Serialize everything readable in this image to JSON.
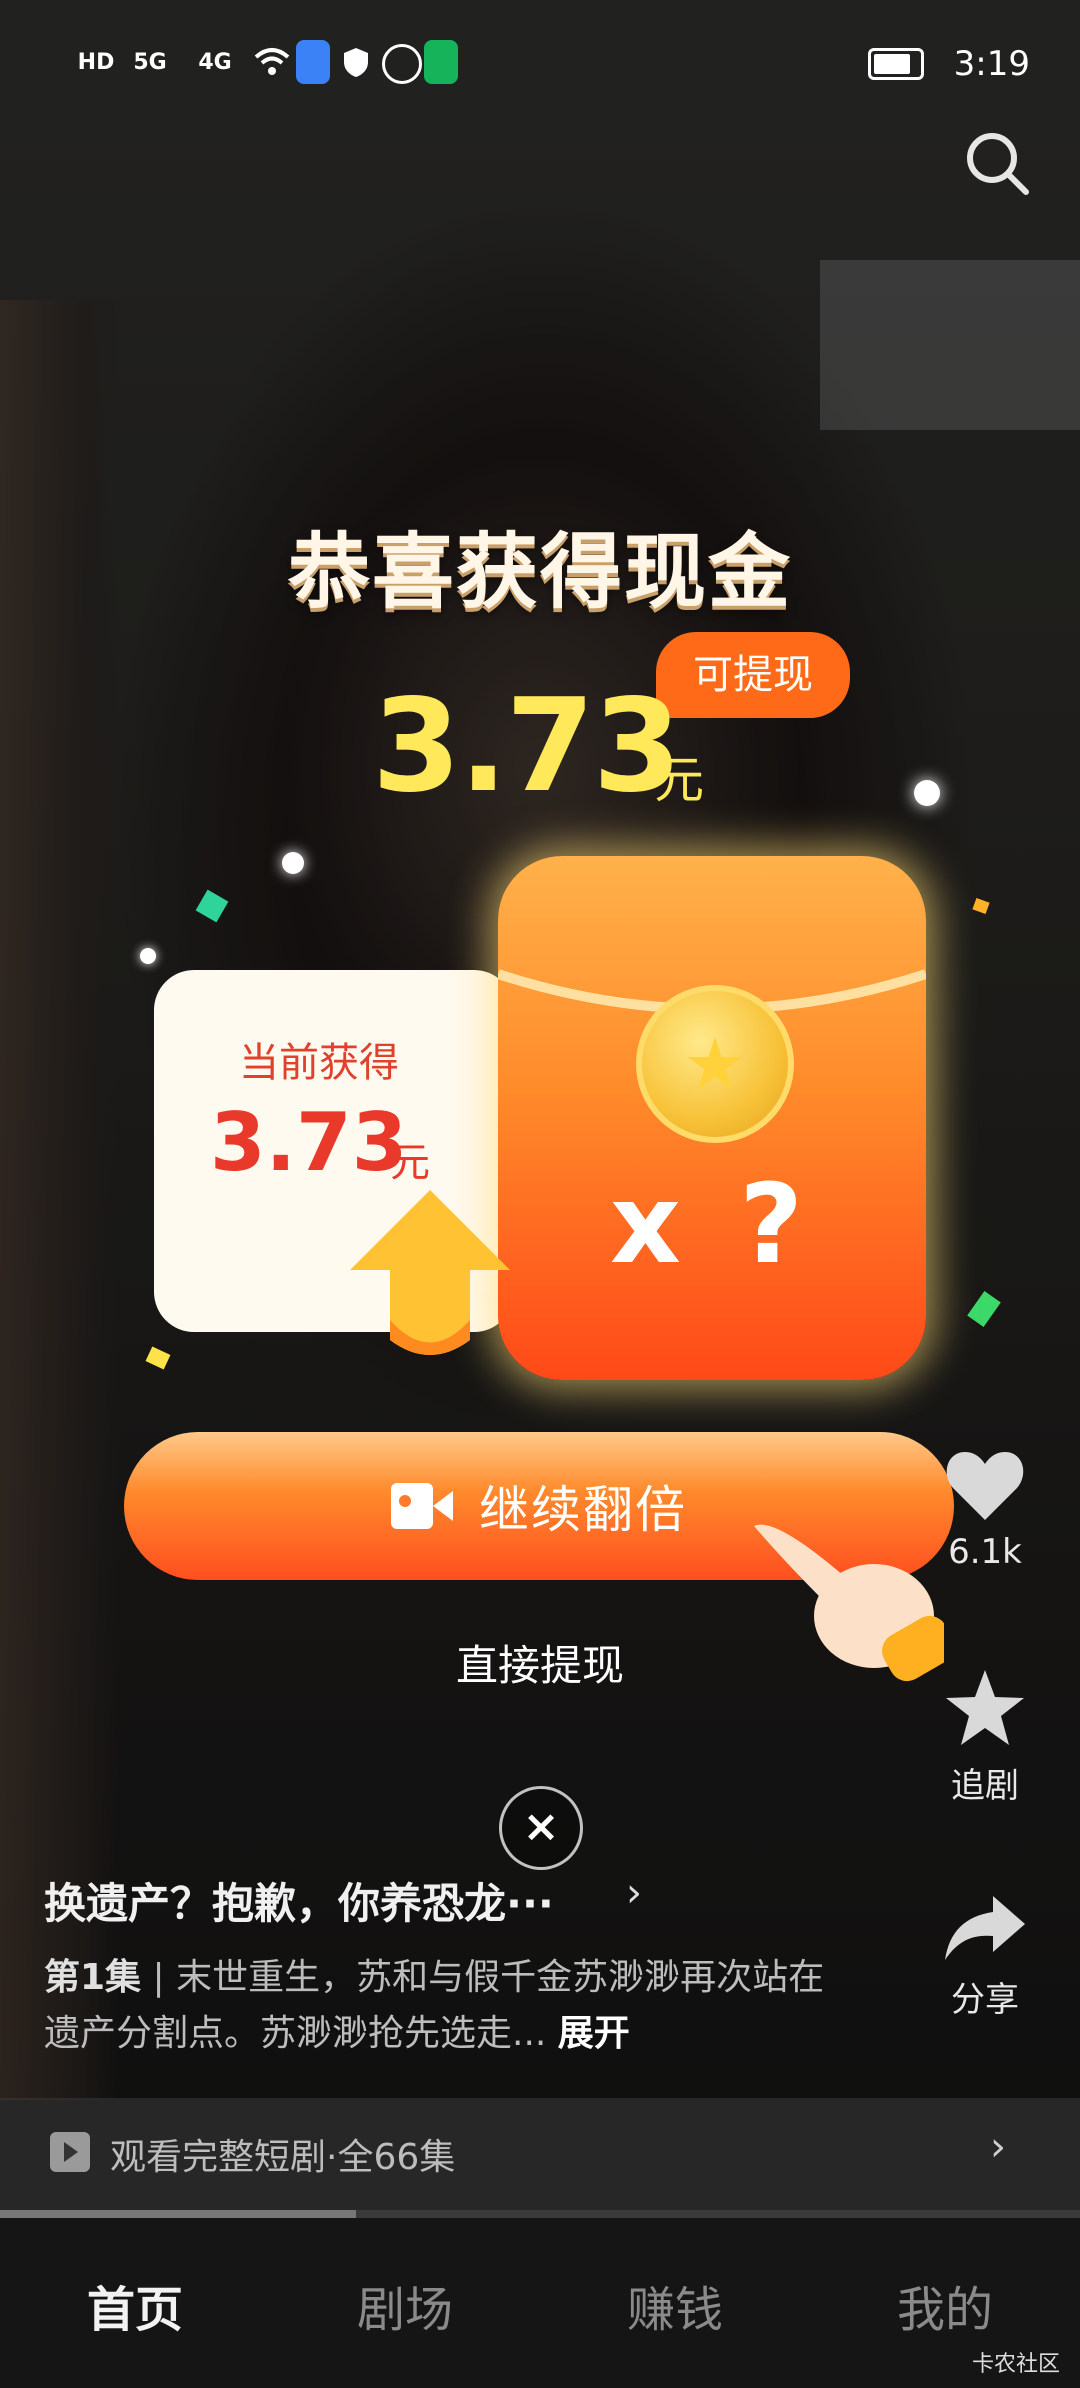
{
  "status_bar": {
    "time": "3:19",
    "indicators": [
      "HD1",
      "HD2",
      "5G",
      "4G",
      "wifi",
      "app-icon",
      "shield-icon",
      "hand-icon",
      "location-icon"
    ]
  },
  "popup": {
    "title": "恭喜获得现金",
    "badge": "可提现",
    "amount": "3.73",
    "unit": "元",
    "card_label": "当前获得",
    "card_amount": "3.73",
    "card_unit": "元",
    "envelope_text": "x ?",
    "double_button": "继续翻倍",
    "withdraw_link": "直接提现",
    "close": "×"
  },
  "rail": {
    "like_count": "6.1k",
    "follow_label": "追剧",
    "share_label": "分享"
  },
  "drama": {
    "title": "换遗产？抱歉，你养恐龙···",
    "episode": "第1集",
    "separator": " | ",
    "description": "末世重生，苏和与假千金苏渺渺再次站在遗产分割点。苏渺渺抢先选走...",
    "expand": "展开"
  },
  "watch_bar": {
    "text": "观看完整短剧·全66集",
    "progress": 0.33
  },
  "nav": {
    "items": [
      {
        "label": "首页",
        "active": true
      },
      {
        "label": "剧场",
        "active": false
      },
      {
        "label": "赚钱",
        "active": false
      },
      {
        "label": "我的",
        "active": false
      }
    ]
  },
  "watermark": "卡农社区",
  "colors": {
    "accent_orange": "#ff6a18",
    "amount_yellow": "#ffe95a",
    "card_red": "#e8392b"
  }
}
